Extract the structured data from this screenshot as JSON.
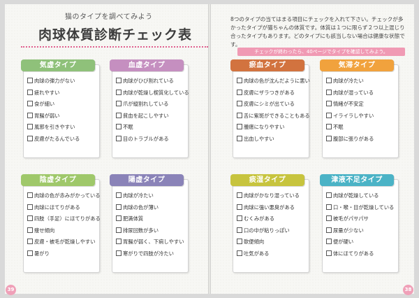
{
  "header": {
    "subtitle": "猫のタイプを調べてみよう",
    "title": "肉球体質診断チェック表"
  },
  "instructions": {
    "text": "8つのタイプの当てはまる項目にチェックを入れて下さい。チェックが多かったタイプが猫ちゃんの体質です。体質は１つに限らず２つ以上混じり合ったタイプもあります。どのタイプにも該当しない場合は健康な状態です。",
    "note": "チェックが終わったら、40ページでタイプを確認してみよう。"
  },
  "types": [
    {
      "label": "気虚タイプ",
      "color": "#8fc17a",
      "items": [
        "肉球の弾力がない",
        "疲れやすい",
        "食が細い",
        "胃腸が弱い",
        "風邪を引きやすい",
        "皮膚がたるんでいる"
      ]
    },
    {
      "label": "血虚タイプ",
      "color": "#c58fc0",
      "items": [
        "肉球がひび割れている",
        "肉球が乾燥し楔質化している",
        "爪が縦割れしている",
        "貧血を起こしやすい",
        "不眠",
        "目のトラブルがある"
      ]
    },
    {
      "label": "瘀血タイプ",
      "color": "#d2733f",
      "items": [
        "肉球の色が沈んだように悪い",
        "皮膚にザラつきがある",
        "皮膚にシミが出ている",
        "舌に紫斑ができることもある",
        "腫瘍になりやすい",
        "出血しやすい"
      ]
    },
    {
      "label": "気滞タイプ",
      "color": "#f1a23d",
      "items": [
        "肉球が冷たい",
        "肉球が湿っている",
        "情緒が不安定",
        "イライラしやすい",
        "不眠",
        "腹部に張りがある"
      ]
    },
    {
      "label": "陰虚タイプ",
      "color": "#9fc86a",
      "items": [
        "肉球の色が赤みがかっている",
        "肉球にほてりがある",
        "四肢（手足）にほてりがある",
        "痩せ傾向",
        "皮膚・被毛が乾燥しやすい",
        "暑がり"
      ]
    },
    {
      "label": "陽虚タイプ",
      "color": "#8a83b8",
      "items": [
        "肉球が冷たい",
        "肉球の色が薄い",
        "肥満体質",
        "排尿回数が多い",
        "胃腸が弱く、下痢しやすい",
        "寒がりで四肢が冷たい"
      ]
    },
    {
      "label": "痰湿タイプ",
      "color": "#c7c43e",
      "items": [
        "肉球がかなり湿っている",
        "肉球に強い悪臭がある",
        "むくみがある",
        "口の中が粘りっぽい",
        "軟便傾向",
        "吐気がある"
      ]
    },
    {
      "label": "津液不足タイプ",
      "color": "#4bb3c6",
      "items": [
        "肉球が乾燥している",
        "口・喉・目が乾燥している",
        "被毛がパサパサ",
        "尿量が少ない",
        "便が硬い",
        "体にほてりがある"
      ]
    }
  ],
  "page_numbers": {
    "left": "39",
    "right": "38"
  }
}
